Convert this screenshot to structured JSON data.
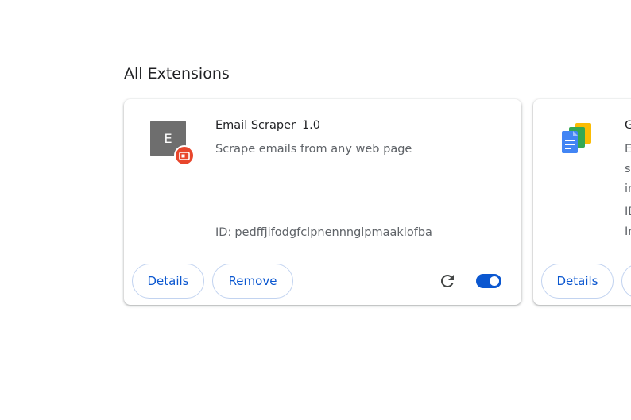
{
  "section": {
    "title": "All Extensions"
  },
  "extensions": [
    {
      "icon_letter": "E",
      "name": "Email Scraper",
      "version": "1.0",
      "description": "Scrape emails from any web page",
      "id_label": "ID:",
      "id_value": "pedffjifodgfclpnennnglpmaaklofba",
      "details_label": "Details",
      "remove_label": "Remove",
      "enabled": true,
      "icon": "letter-e-icon",
      "badge_icon": "unpacked-badge-icon",
      "reload_icon": "reload-icon"
    },
    {
      "name": "G",
      "desc_1": "E",
      "desc_2": "s",
      "desc_3": "in",
      "id": "ID",
      "inspect": "In",
      "details_label": "Details",
      "icon": "google-docs-icon"
    }
  ],
  "colors": {
    "accent": "#0b57d0",
    "badge": "#e8462c",
    "icon_bg": "#6e6e6e"
  }
}
